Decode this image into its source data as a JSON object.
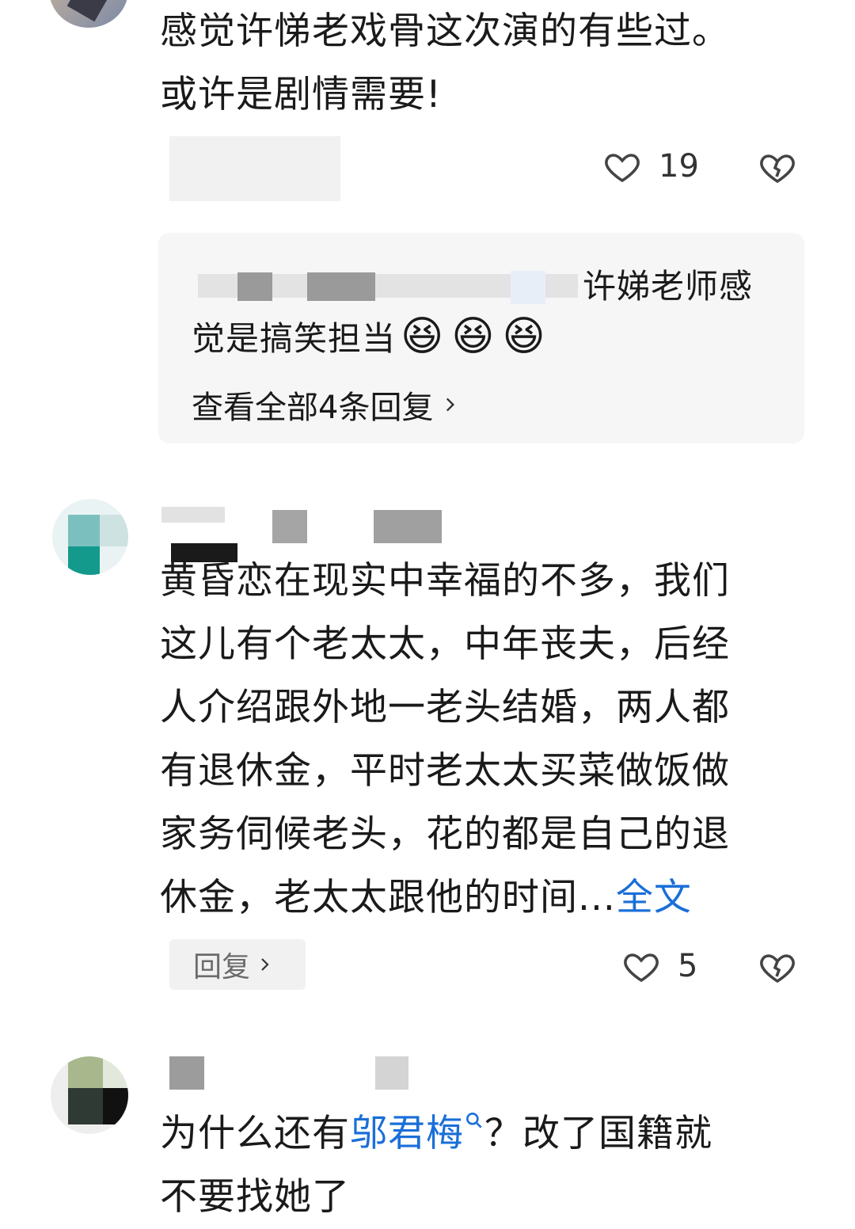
{
  "comments": [
    {
      "text_line1": "感觉许悌老戏骨这次演的有些过。",
      "text_line2": "或许是剧情需要!",
      "likes": "19"
    },
    {
      "reply_preview": {
        "text_line1_tail": "许娣老师感",
        "text_line2": "觉是搞笑担当",
        "emoji": "😆😆😆",
        "view_all": "查看全部4条回复"
      }
    },
    {
      "text_lines": [
        "黄昏恋在现实中幸福的不多，我们",
        "这儿有个老太太，中年丧夫，后经",
        "人介绍跟外地一老头结婚，两人都",
        "有退休金，平时老太太买菜做饭做",
        "家务伺候老头，花的都是自己的退"
      ],
      "last_line_prefix": "休金，老太太跟他的时间...",
      "full_text_link": "全文",
      "reply_button": "回复",
      "likes": "5"
    },
    {
      "line1_prefix": "为什么还有",
      "highlight_name": "邬君梅",
      "line1_suffix": "？改了国籍就",
      "line2": "不要找她了"
    }
  ],
  "colors": {
    "link": "#1a6fd8",
    "text": "#1a1a1a",
    "reply_bg": "#f6f6f6"
  },
  "icons": [
    "heart-outline-icon",
    "broken-heart-icon",
    "chevron-right-icon",
    "search-small-icon"
  ]
}
